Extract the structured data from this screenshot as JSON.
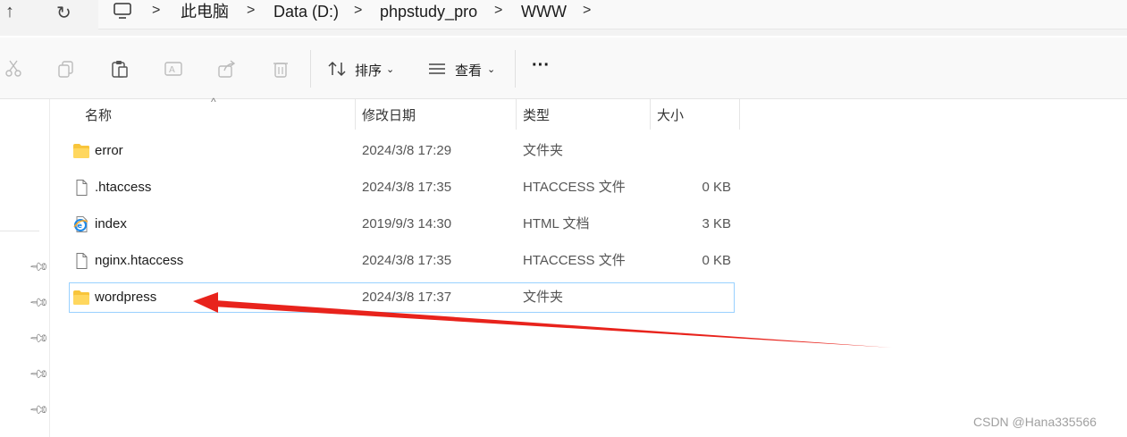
{
  "breadcrumb": [
    "此电脑",
    "Data (D:)",
    "phpstudy_pro",
    "WWW"
  ],
  "toolbar": {
    "sort_label": "排序",
    "view_label": "查看",
    "more_label": "···"
  },
  "columns": {
    "name": "名称",
    "modified": "修改日期",
    "type": "类型",
    "size": "大小"
  },
  "files": [
    {
      "name": "error",
      "modified": "2024/3/8 17:29",
      "type": "文件夹",
      "size": "",
      "icon": "folder-icon"
    },
    {
      "name": ".htaccess",
      "modified": "2024/3/8 17:35",
      "type": "HTACCESS 文件",
      "size": "0 KB",
      "icon": "file-icon"
    },
    {
      "name": "index",
      "modified": "2019/9/3 14:30",
      "type": "HTML 文档",
      "size": "3 KB",
      "icon": "ie-html-icon"
    },
    {
      "name": "nginx.htaccess",
      "modified": "2024/3/8 17:35",
      "type": "HTACCESS 文件",
      "size": "0 KB",
      "icon": "file-icon"
    },
    {
      "name": "wordpress",
      "modified": "2024/3/8 17:37",
      "type": "文件夹",
      "size": "",
      "icon": "folder-icon",
      "selected": true
    }
  ],
  "watermark": "CSDN @Hana335566",
  "colors": {
    "accent": "#0078d4",
    "arrow": "#e8231c",
    "folder": "#f8c53b",
    "selection_border": "#99d1ff"
  }
}
